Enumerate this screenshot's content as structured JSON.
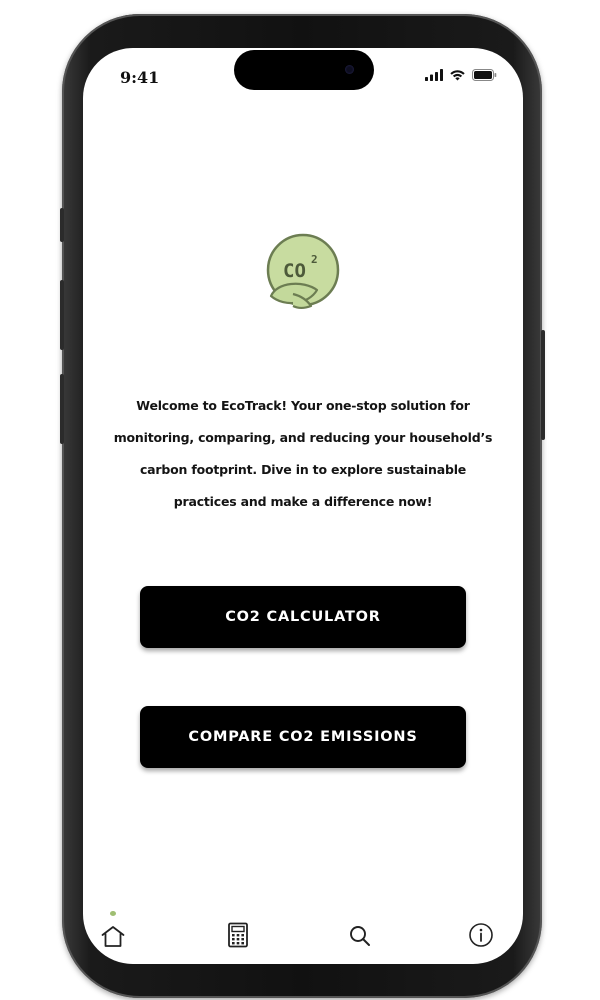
{
  "status_bar": {
    "time": "9:41",
    "icons": [
      "cellular-signal-icon",
      "wifi-icon",
      "battery-icon"
    ]
  },
  "logo": {
    "icon": "co2-leaf-icon",
    "text_main": "CO",
    "text_sup": "2",
    "colors": {
      "fill": "#c8dca0",
      "stroke": "#6c7d52",
      "leaf": "#c3d99b"
    }
  },
  "welcome_text": "Welcome to EcoTrack! Your one-stop solution for monitoring, comparing, and reducing your household’s carbon footprint. Dive in to explore sustainable practices and make a difference now!",
  "buttons": {
    "calculator_label": "CO2 CALCULATOR",
    "compare_label": "COMPARE CO2 EMISSIONS"
  },
  "tab_bar": {
    "items": [
      {
        "name": "home",
        "icon": "home-icon",
        "active": true
      },
      {
        "name": "calculator",
        "icon": "calculator-icon",
        "active": false
      },
      {
        "name": "search",
        "icon": "search-icon",
        "active": false
      },
      {
        "name": "info",
        "icon": "info-icon",
        "active": false
      }
    ],
    "active_indicator_color": "#9fbe72"
  },
  "colors": {
    "button_bg": "#000000",
    "button_text": "#ffffff",
    "screen_bg": "#ffffff",
    "text": "#141414"
  }
}
